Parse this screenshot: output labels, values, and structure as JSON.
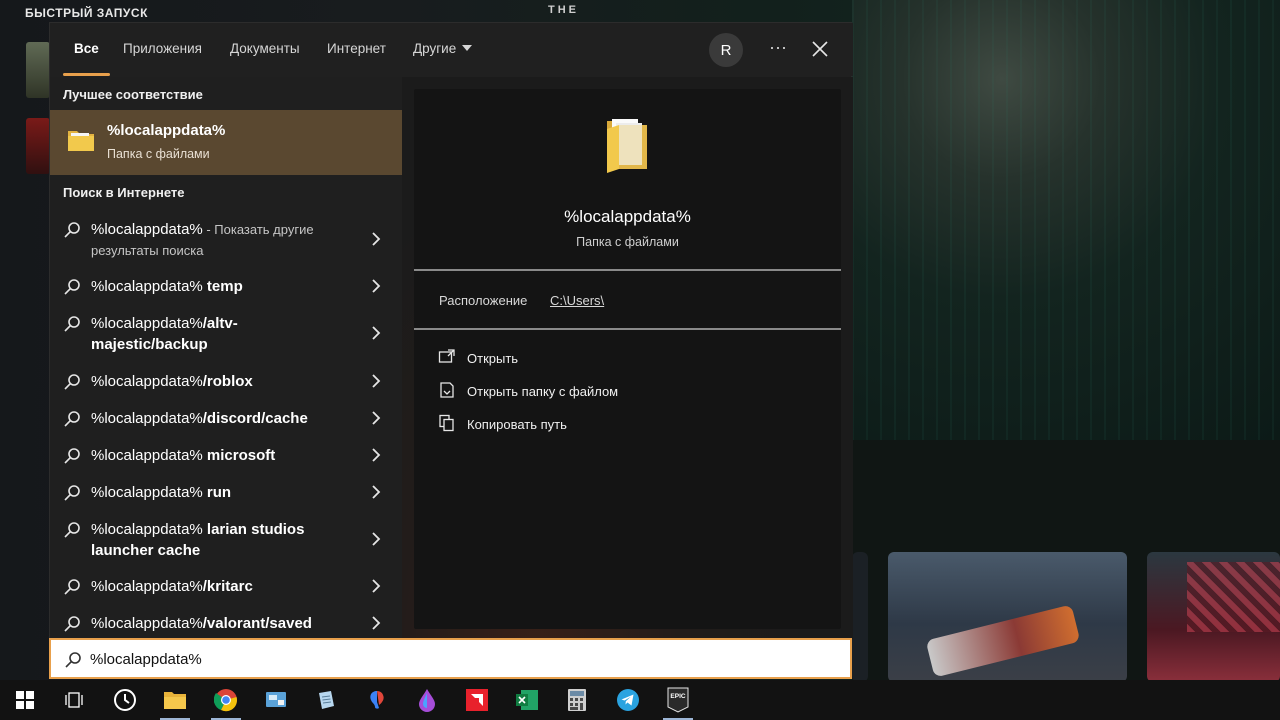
{
  "background": {
    "quick_launch_title": "БЫСТРЫЙ ЗАПУСК",
    "hero_text": "THE"
  },
  "tabs": [
    {
      "label": "Все",
      "active": true
    },
    {
      "label": "Приложения"
    },
    {
      "label": "Документы"
    },
    {
      "label": "Интернет"
    },
    {
      "label": "Другие"
    }
  ],
  "header": {
    "avatar_initial": "R",
    "more_icon": "ellipsis-icon",
    "close_icon": "close-icon"
  },
  "best_match": {
    "section_title": "Лучшее соответствие",
    "name": "%localappdata%",
    "type": "Папка с файлами",
    "icon": "folder-icon"
  },
  "web_search": {
    "section_title": "Поиск в Интернете",
    "items": [
      {
        "query": "%localappdata%",
        "suffix": "",
        "note": " - Показать другие результаты поиска"
      },
      {
        "query": "%localappdata%",
        "suffix": " temp",
        "note": ""
      },
      {
        "query": "%localappdata%",
        "suffix": "/altv-majestic/backup",
        "note": ""
      },
      {
        "query": "%localappdata%",
        "suffix": "/roblox",
        "note": ""
      },
      {
        "query": "%localappdata%",
        "suffix": "/discord/cache",
        "note": ""
      },
      {
        "query": "%localappdata%",
        "suffix": " microsoft",
        "note": ""
      },
      {
        "query": "%localappdata%",
        "suffix": " run",
        "note": ""
      },
      {
        "query": "%localappdata%",
        "suffix": " larian studios launcher cache",
        "note": ""
      },
      {
        "query": "%localappdata%",
        "suffix": "/kritarc",
        "note": ""
      },
      {
        "query": "%localappdata%",
        "suffix": "/valorant/saved",
        "note": ""
      }
    ]
  },
  "preview": {
    "name": "%localappdata%",
    "type": "Папка с файлами",
    "location_label": "Расположение",
    "location_value": "C:\\Users\\",
    "actions": [
      {
        "label": "Открыть",
        "icon": "open-icon"
      },
      {
        "label": "Открыть папку с файлом",
        "icon": "open-file-location-icon"
      },
      {
        "label": "Копировать путь",
        "icon": "copy-icon"
      }
    ]
  },
  "search": {
    "value": "%localappdata%"
  },
  "taskbar": {
    "items": [
      {
        "icon": "windows-start-icon"
      },
      {
        "icon": "task-view-icon"
      },
      {
        "icon": "clock-app-icon"
      },
      {
        "icon": "file-explorer-icon"
      },
      {
        "icon": "chrome-icon"
      },
      {
        "icon": "control-panel-icon"
      },
      {
        "icon": "notes-app-icon"
      },
      {
        "icon": "paint-app-icon"
      },
      {
        "icon": "drop-app-icon"
      },
      {
        "icon": "amd-software-icon"
      },
      {
        "icon": "excel-icon"
      },
      {
        "icon": "calculator-icon"
      },
      {
        "icon": "telegram-icon"
      },
      {
        "icon": "epic-games-icon",
        "label": "EPIC"
      }
    ]
  }
}
